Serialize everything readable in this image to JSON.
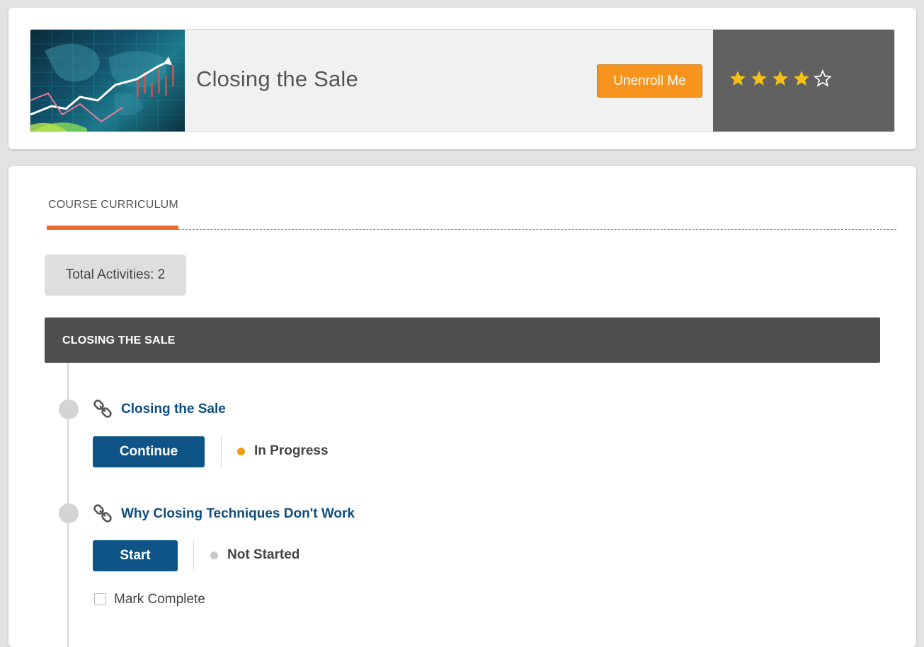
{
  "course": {
    "title": "Closing the Sale",
    "unenroll_label": "Unenroll Me",
    "rating": {
      "value": 4,
      "max": 5
    }
  },
  "curriculum": {
    "tab_label": "COURSE CURRICULUM",
    "total_activities": "Total Activities: 2",
    "section_title": "CLOSING THE SALE",
    "activities": [
      {
        "title": "Closing the Sale",
        "icon": "link-icon",
        "action_label": "Continue",
        "status": "In Progress",
        "status_color": "#f39c12"
      },
      {
        "title": "Why Closing Techniques Don't Work",
        "icon": "link-icon",
        "action_label": "Start",
        "status": "Not Started",
        "status_color": "#c8c8c8"
      }
    ],
    "mark_complete_label": "Mark Complete"
  },
  "colors": {
    "accent_orange": "#f7941d",
    "tab_underline": "#ea6b2d",
    "primary_blue": "#0e5486",
    "link_blue": "#0e4d7d",
    "star_gold": "#f5c018"
  }
}
